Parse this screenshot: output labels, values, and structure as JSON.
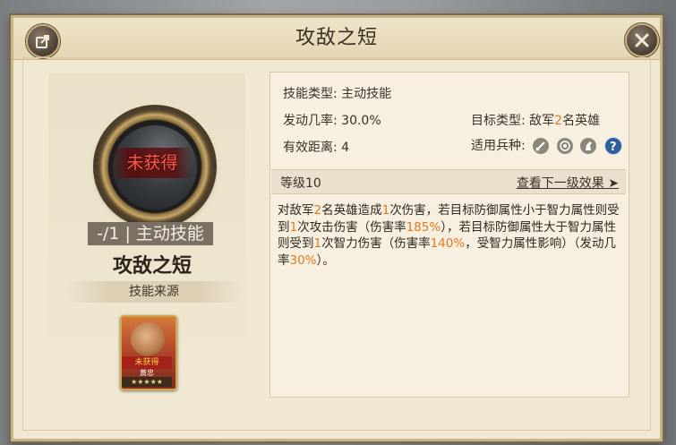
{
  "window": {
    "title": "攻敌之短"
  },
  "buttons": {
    "share": "share-icon",
    "close": "close-icon"
  },
  "left": {
    "status": "未获得",
    "level_tag": "-/1 | 主动技能",
    "skill_name": "攻敌之短",
    "source_label": "技能来源",
    "hero": {
      "badge": "未获得",
      "name": "黄忠",
      "stars": "★★★★★"
    }
  },
  "info": {
    "type_label": "技能类型:",
    "type_value": "主动技能",
    "rate_label": "发动几率:",
    "rate_value": "30.0%",
    "target_label": "目标类型:",
    "target_prefix": "敌军",
    "target_num": "2",
    "target_suffix": "名英雄",
    "range_label": "有效距离:",
    "range_value": "4",
    "troops_label": "适用兵种:",
    "troop_icons": [
      "sword-icon",
      "bow-target-icon",
      "horse-icon",
      "question-icon"
    ]
  },
  "level": {
    "label": "等级10",
    "next": "查看下一级效果 ➤"
  },
  "description": {
    "p1": "对敌军",
    "n1": "2",
    "p2": "名英雄造成",
    "n2": "1",
    "p3": "次伤害，若目标防御属性小于智力属性则受到",
    "n3": "1",
    "p4": "次攻击伤害（伤害率",
    "n4": "185%",
    "p5": "），若目标防御属性大于智力属性则受到",
    "n5": "1",
    "p6": "次智力伤害（伤害率",
    "n6": "140%",
    "p7": "，受智力属性影响）（发动几率",
    "n7": "30%",
    "p8": "）。"
  },
  "colors": {
    "highlight": "#e07820",
    "panel": "#f1e8d3",
    "unobtained": "#ff5a4a"
  }
}
